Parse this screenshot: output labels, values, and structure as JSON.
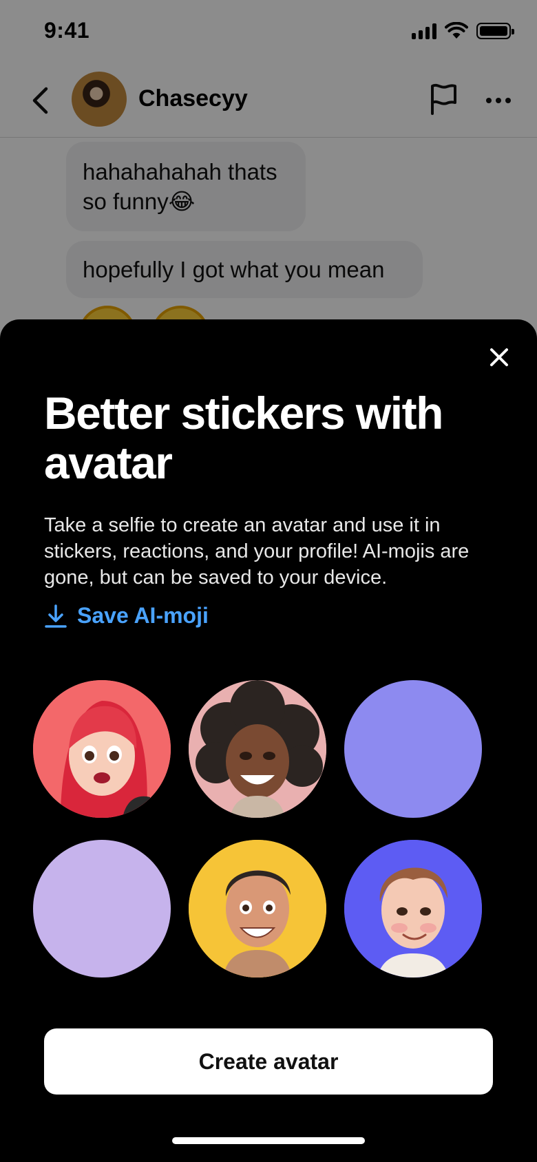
{
  "status_bar": {
    "time": "9:41"
  },
  "chat_header": {
    "contact_name": "Chasecyy"
  },
  "messages": [
    {
      "text": "hahahahahah thats so funny😂"
    },
    {
      "text": "hopefully I got what you mean"
    }
  ],
  "sheet": {
    "title": "Better stickers with avatar",
    "description": "Take a selfie to create an avatar and use it in stickers, reactions, and your profile! AI-mojis are gone, but can be saved to your device.",
    "save_link_label": "Save AI-moji",
    "create_button_label": "Create avatar"
  },
  "colors": {
    "link": "#4aa3ff",
    "sheet_background": "#000000",
    "avatar_bg_red": "#f3686a",
    "avatar_bg_pink": "#e9b0b0",
    "avatar_bg_periwinkle": "#8d8af0",
    "avatar_bg_lavender": "#c6b3ec",
    "avatar_bg_yellow": "#f6c437",
    "avatar_bg_blue": "#5d5cf3"
  }
}
